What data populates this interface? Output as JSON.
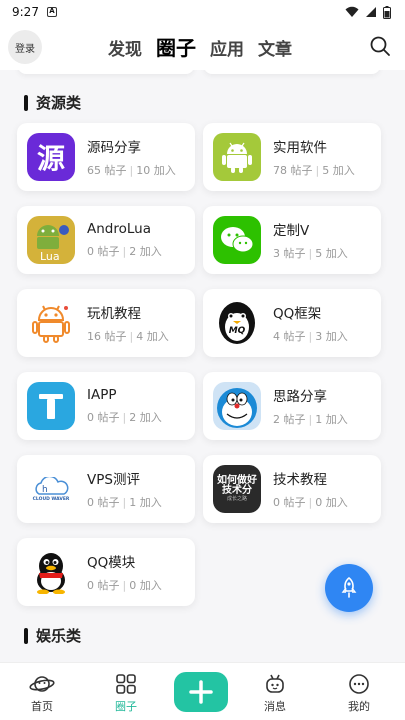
{
  "status_bar": {
    "time": "9:27"
  },
  "header": {
    "login_label": "登录",
    "tabs": [
      {
        "label": "发现"
      },
      {
        "label": "圈子"
      },
      {
        "label": "应用"
      },
      {
        "label": "文章"
      }
    ]
  },
  "sections": {
    "resources": {
      "title": "资源类"
    },
    "entertainment": {
      "title": "娱乐类"
    }
  },
  "circles": [
    {
      "name": "源码分享",
      "posts": "65 帖子",
      "joins": "10 加入",
      "icon": "yuan-logo-icon"
    },
    {
      "name": "实用软件",
      "posts": "78 帖子",
      "joins": "5 加入",
      "icon": "android-icon"
    },
    {
      "name": "AndroLua",
      "posts": "0 帖子",
      "joins": "2 加入",
      "icon": "androlua-icon"
    },
    {
      "name": "定制V",
      "posts": "3 帖子",
      "joins": "5 加入",
      "icon": "wechat-icon"
    },
    {
      "name": "玩机教程",
      "posts": "16 帖子",
      "joins": "4 加入",
      "icon": "android-outline-icon"
    },
    {
      "name": "QQ框架",
      "posts": "4 帖子",
      "joins": "3 加入",
      "icon": "penguin-mq-icon"
    },
    {
      "name": "IAPP",
      "posts": "0 帖子",
      "joins": "2 加入",
      "icon": "iapp-icon"
    },
    {
      "name": "思路分享",
      "posts": "2 帖子",
      "joins": "1 加入",
      "icon": "doraemon-icon"
    },
    {
      "name": "VPS测评",
      "posts": "0 帖子",
      "joins": "1 加入",
      "icon": "cloud-waver-icon"
    },
    {
      "name": "技术教程",
      "posts": "0 帖子",
      "joins": "0 加入",
      "icon": "tech-tutorial-icon"
    },
    {
      "name": "QQ模块",
      "posts": "0 帖子",
      "joins": "0 加入",
      "icon": "qq-penguin-icon"
    }
  ],
  "icon_text": {
    "yuan": "源",
    "lua": "Lua",
    "mq": "MQ",
    "cloud": "CLOUD WAVER",
    "tech_line1": "如何做好",
    "tech_line2": "技术分",
    "tech_line3": "成长之路"
  },
  "bottom_nav": [
    {
      "label": "首页"
    },
    {
      "label": "圈子"
    },
    {
      "label": "消息"
    },
    {
      "label": "我的"
    }
  ],
  "colors": {
    "accent": "#23c4a3",
    "fab": "#2f86f3"
  }
}
